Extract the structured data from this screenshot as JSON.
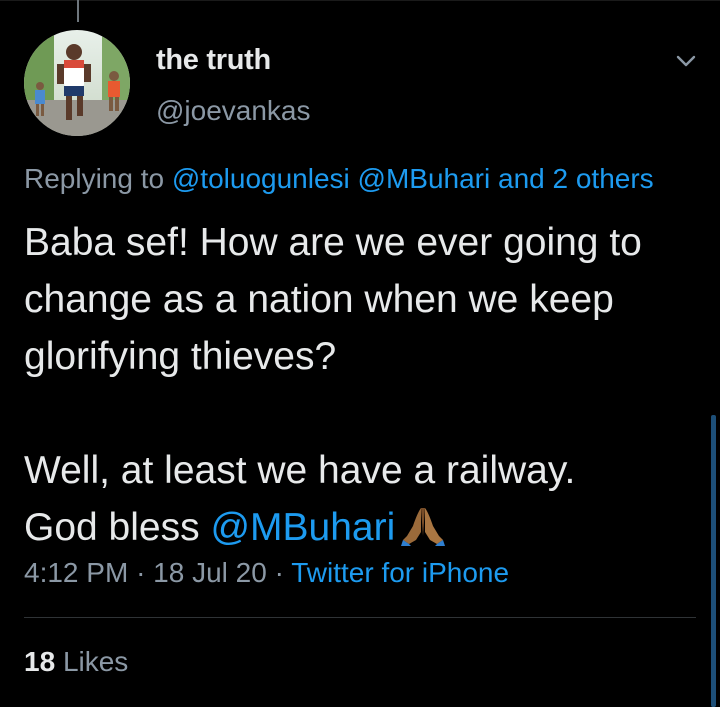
{
  "author": {
    "display_name": "the truth",
    "handle": "@joevankas"
  },
  "reply_context": {
    "prefix": "Replying to",
    "mentions": [
      "@toluogunlesi",
      "@MBuhari"
    ],
    "and_others": "and 2 others"
  },
  "tweet": {
    "paragraph1": "Baba sef! How are we ever going to change as a nation when we keep glorifying thieves?",
    "paragraph2_line1": "Well, at least we have a railway.",
    "paragraph2_prefix": "God bless",
    "paragraph2_mention": "@MBuhari",
    "emoji": "folded-hands"
  },
  "meta": {
    "time": "4:12 PM",
    "separator": "·",
    "date": "18 Jul 20",
    "source": "Twitter for iPhone"
  },
  "engagement": {
    "likes_count": "18",
    "likes_label": "Likes"
  },
  "colors": {
    "background": "#000000",
    "text": "#e7e9ea",
    "secondary": "#8b98a5",
    "link": "#1d9bf0"
  }
}
